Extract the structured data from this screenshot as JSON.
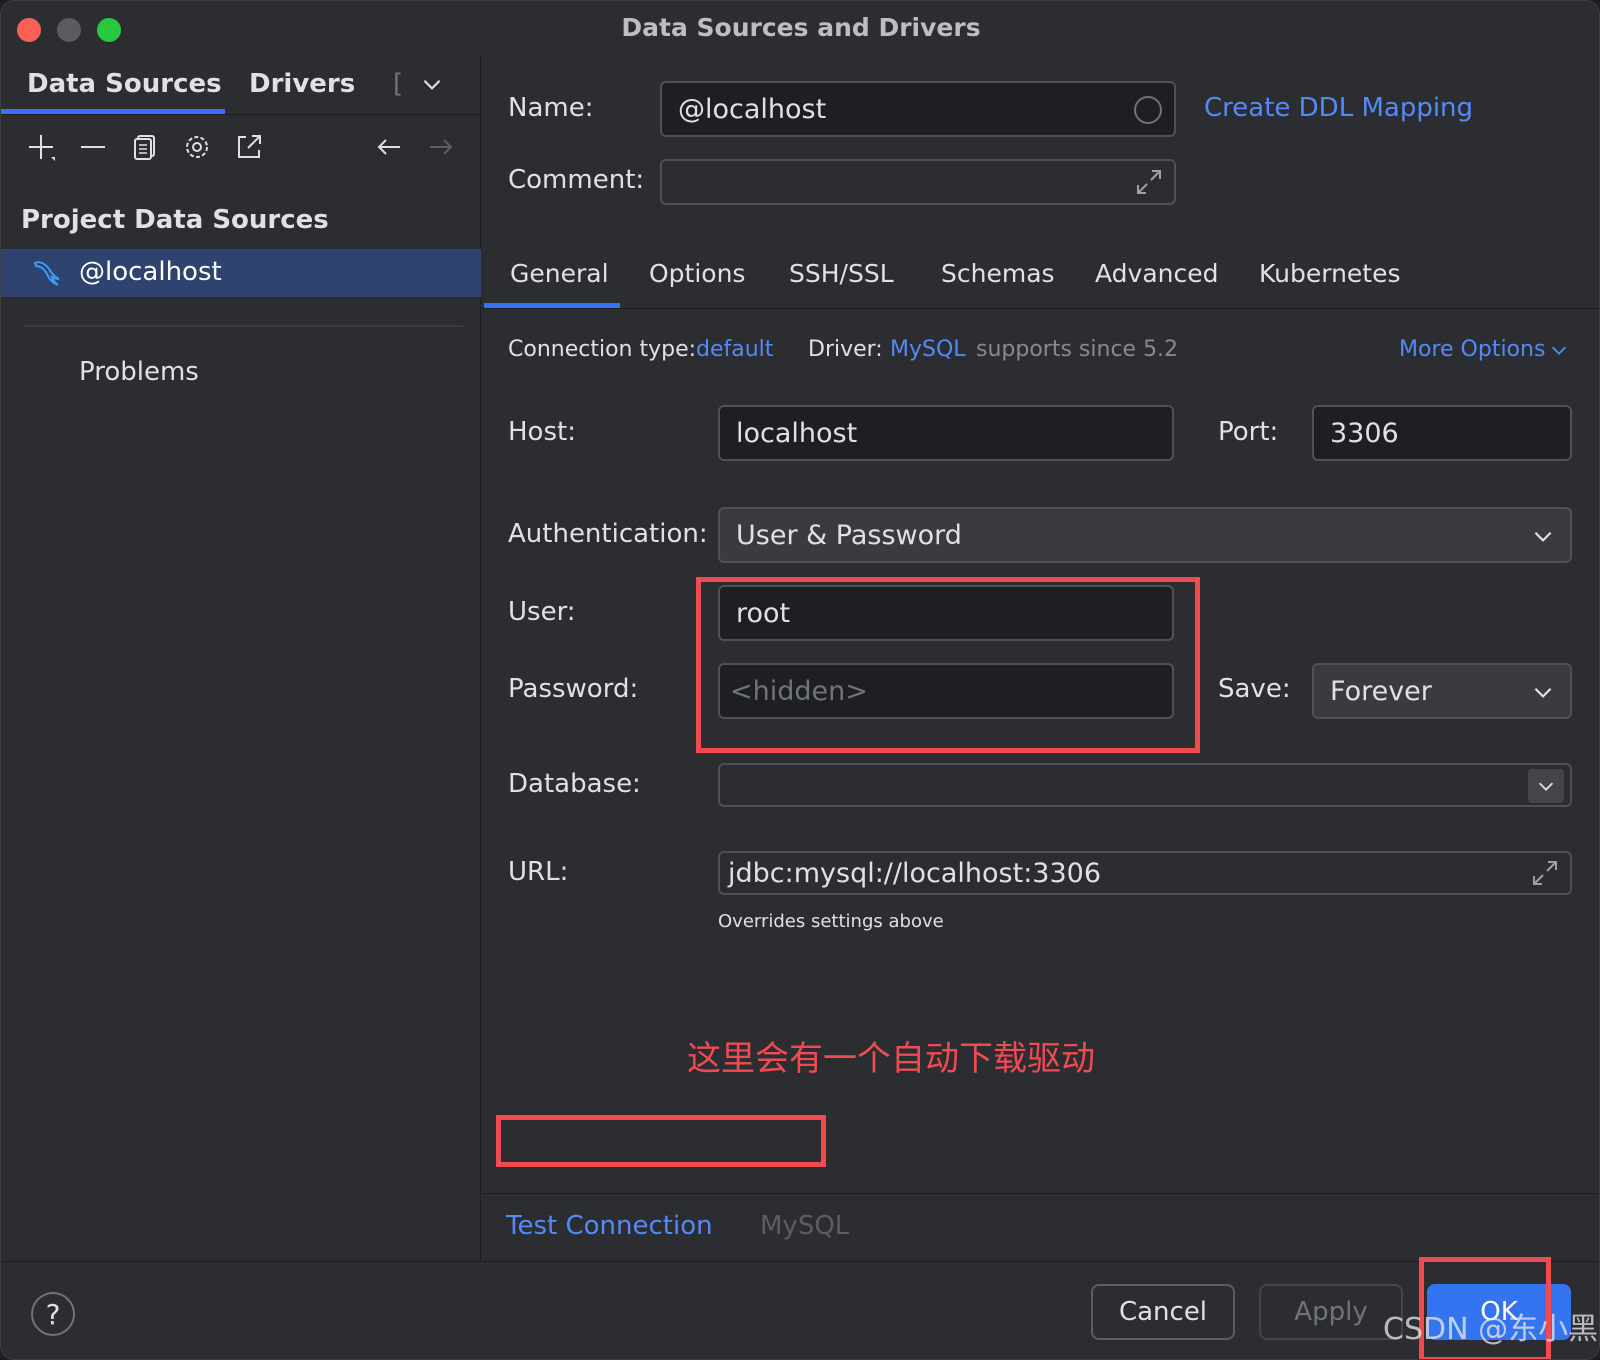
{
  "window": {
    "title": "Data Sources and Drivers"
  },
  "left": {
    "tabs": [
      {
        "label": "Data Sources",
        "active": true
      },
      {
        "label": "Drivers",
        "active": false
      }
    ],
    "tabs_more": "[",
    "toolbar_icons": [
      "add-icon",
      "remove-icon",
      "copy-icon",
      "settings-icon",
      "open-external-icon",
      "back-arrow-icon",
      "forward-arrow-icon"
    ],
    "section_title": "Project Data Sources",
    "items": [
      {
        "label": "@localhost",
        "icon": "mysql-dolphin-icon",
        "selected": true
      }
    ],
    "problems_label": "Problems"
  },
  "right": {
    "name_label": "Name:",
    "name_value": "@localhost",
    "create_ddl_link": "Create DDL Mapping",
    "comment_label": "Comment:",
    "comment_value": "",
    "tabs": [
      "General",
      "Options",
      "SSH/SSL",
      "Schemas",
      "Advanced",
      "Kubernetes"
    ],
    "active_tab": "General",
    "connection_type_label": "Connection type:",
    "connection_type_value": "default",
    "driver_label": "Driver:",
    "driver_value": "MySQL",
    "driver_note": "supports since 5.2",
    "more_options": "More Options",
    "host_label": "Host:",
    "host_value": "localhost",
    "port_label": "Port:",
    "port_value": "3306",
    "auth_label": "Authentication:",
    "auth_value": "User & Password",
    "user_label": "User:",
    "user_value": "root",
    "password_label": "Password:",
    "password_placeholder": "<hidden>",
    "save_label": "Save:",
    "save_value": "Forever",
    "database_label": "Database:",
    "database_value": "",
    "url_label": "URL:",
    "url_value": "jdbc:mysql://localhost:3306",
    "url_note": "Overrides settings above",
    "annotation_text": "这里会有一个自动下载驱动",
    "test_connection": "Test Connection",
    "driver_footer": "MySQL"
  },
  "footer": {
    "help": "?",
    "cancel": "Cancel",
    "apply": "Apply",
    "ok": "OK",
    "watermark": "CSDN @东小黑"
  },
  "colors": {
    "accent": "#3574f0",
    "link": "#548af7",
    "annotation": "#ef4b50",
    "selection": "#2e436e"
  }
}
